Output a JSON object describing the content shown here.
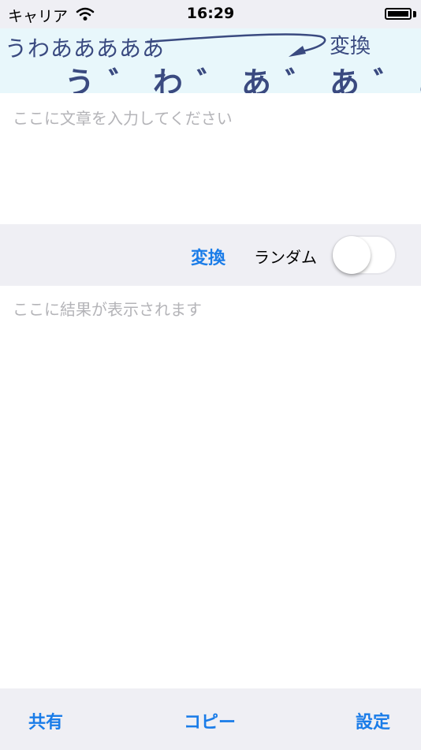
{
  "status_bar": {
    "carrier": "キャリア",
    "time": "16:29",
    "wifi_icon": "wifi-icon",
    "battery_icon": "battery-icon"
  },
  "banner": {
    "source_text": "うわあああああ",
    "label": "変換",
    "result_text": "う゛わ゛あ゛あ゛あ゛あ゛",
    "text_color": "#3a4a80",
    "background": "#e8f7fb"
  },
  "input": {
    "placeholder": "ここに文章を入力してください"
  },
  "toolbar": {
    "convert_label": "変換",
    "random_label": "ランダム",
    "random_enabled": false
  },
  "result": {
    "placeholder": "ここに結果が表示されます"
  },
  "tab_bar": {
    "share_label": "共有",
    "copy_label": "コピー",
    "settings_label": "設定"
  },
  "colors": {
    "accent": "#1a7ce8",
    "bar_background": "#efeff4",
    "placeholder": "#b4b4b8"
  }
}
